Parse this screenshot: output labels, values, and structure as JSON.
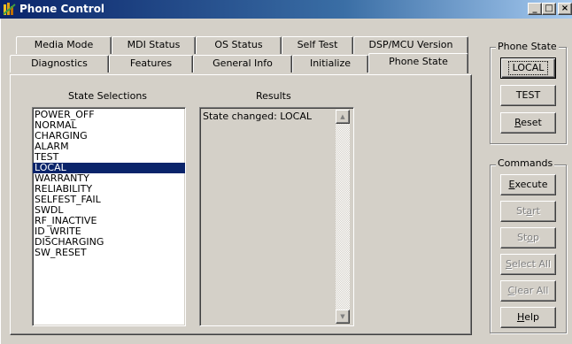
{
  "window": {
    "title": "Phone Control",
    "controls": {
      "minimize": "_",
      "maximize": "□",
      "close": "×"
    }
  },
  "tabs": {
    "row_back": [
      "Media Mode",
      "MDI Status",
      "OS Status",
      "Self Test",
      "DSP/MCU Version"
    ],
    "row_front": [
      "Diagnostics",
      "Features",
      "General Info",
      "Initialize",
      "Phone State"
    ],
    "active": "Phone State"
  },
  "state_selections": {
    "label": "State Selections",
    "items": [
      "POWER_OFF",
      "NORMAL",
      "CHARGING",
      "ALARM",
      "TEST",
      "LOCAL",
      "WARRANTY",
      "RELIABILITY",
      "SELFEST_FAIL",
      "SWDL",
      "RF_INACTIVE",
      "ID_WRITE",
      "DISCHARGING",
      "SW_RESET"
    ],
    "selected": "LOCAL"
  },
  "results": {
    "label": "Results",
    "text": "State changed: LOCAL"
  },
  "phone_state_group": {
    "label": "Phone State",
    "buttons": [
      {
        "label": "LOCAL",
        "default": true,
        "enabled": true
      },
      {
        "label": "TEST",
        "enabled": true
      },
      {
        "label": "Reset",
        "mnemonic": "R",
        "rest": "eset",
        "enabled": true
      }
    ]
  },
  "commands_group": {
    "label": "Commands",
    "buttons": [
      {
        "label": "Execute",
        "mnemonic": "E",
        "rest": "xecute",
        "enabled": true
      },
      {
        "label": "Start",
        "pre": "St",
        "mnemonic": "a",
        "rest": "rt",
        "enabled": false
      },
      {
        "label": "Stop",
        "pre": "St",
        "mnemonic": "o",
        "rest": "p",
        "enabled": false
      },
      {
        "label": "Select All",
        "pre": "",
        "mnemonic": "S",
        "rest": "elect All",
        "enabled": false
      },
      {
        "label": "Clear All",
        "pre": "",
        "mnemonic": "C",
        "rest": "lear All",
        "enabled": false
      },
      {
        "label": "Help",
        "mnemonic": "H",
        "rest": "elp",
        "enabled": true
      }
    ]
  },
  "colors": {
    "title_bar_start": "#0a246a",
    "title_bar_end": "#a6caf0",
    "face": "#d4d0c8",
    "selection": "#0a246a",
    "disabled_text": "#808080"
  }
}
